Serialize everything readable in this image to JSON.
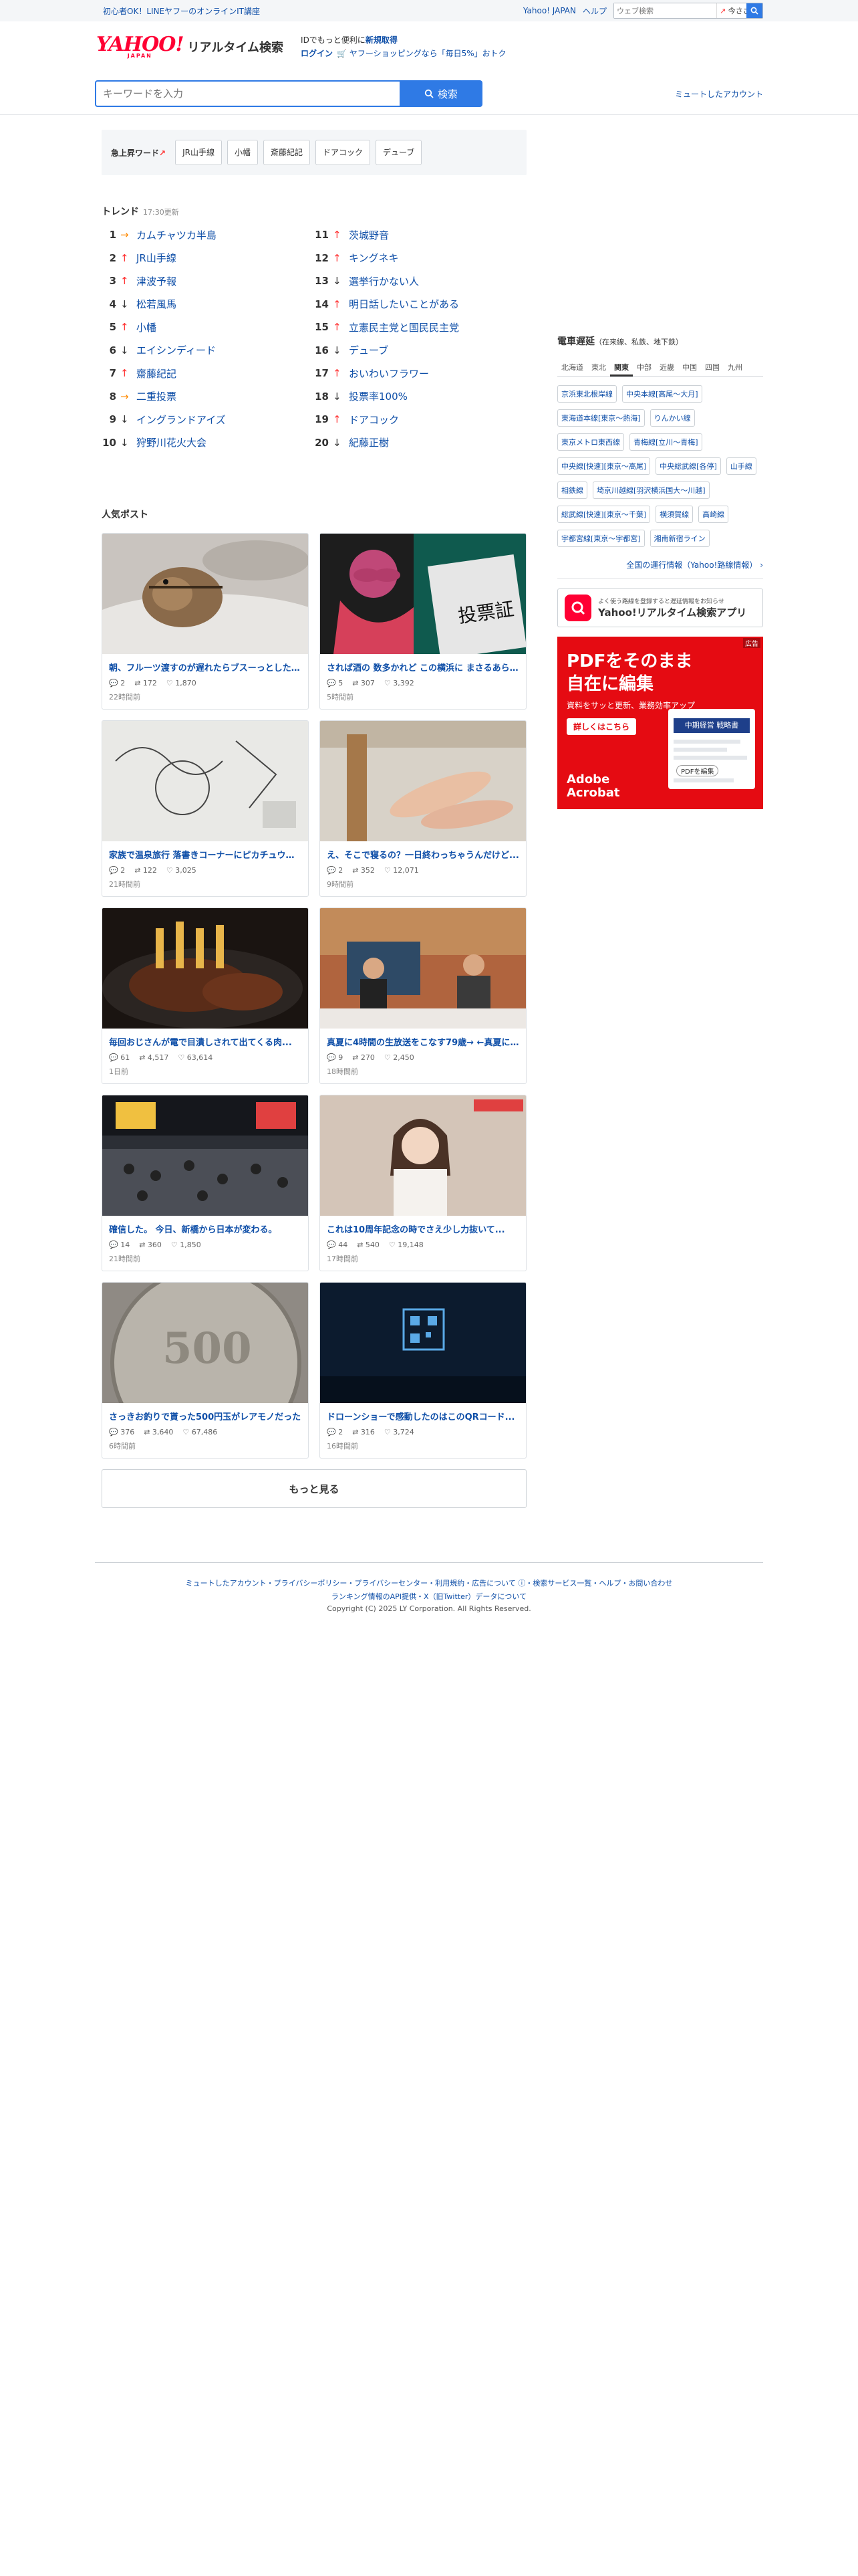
{
  "topbar": {
    "promo": "初心者OK！LINEヤフーのオンラインIT講座",
    "yahoo_japan": "Yahoo! JAPAN",
    "help": "ヘルプ",
    "web_search_placeholder": "ウェブ検索",
    "web_search_trend": "今ささえ行れ...",
    "search_icon": "search-icon"
  },
  "header": {
    "logo_main": "YAHOO!",
    "logo_sub": "JAPAN",
    "service_name": "リアルタイム検索",
    "msg_line1_prefix": "IDでもっと便利に",
    "msg_line1_link": "新規取得",
    "login": "ログイン",
    "msg_line2": "ヤフーショッピングなら「毎日5%」おトク"
  },
  "search": {
    "placeholder": "キーワードを入力",
    "button_label": "検索",
    "mute_link": "ミュートしたアカウント"
  },
  "surge": {
    "title": "急上昇ワード",
    "words": [
      "JR山手線",
      "小幡",
      "斎藤紀記",
      "ドアコック",
      "デューブ"
    ]
  },
  "trend": {
    "title": "トレンド",
    "updated": "17:30更新",
    "items": [
      {
        "rank": "1",
        "dir": "same",
        "word": "カムチャツカ半島"
      },
      {
        "rank": "2",
        "dir": "up",
        "word": "JR山手線"
      },
      {
        "rank": "3",
        "dir": "up",
        "word": "津波予報"
      },
      {
        "rank": "4",
        "dir": "down",
        "word": "松若風馬"
      },
      {
        "rank": "5",
        "dir": "up",
        "word": "小幡"
      },
      {
        "rank": "6",
        "dir": "down",
        "word": "エイシンディード"
      },
      {
        "rank": "7",
        "dir": "up",
        "word": "齋藤紀記"
      },
      {
        "rank": "8",
        "dir": "same",
        "word": "二重投票"
      },
      {
        "rank": "9",
        "dir": "down",
        "word": "イングランドアイズ"
      },
      {
        "rank": "10",
        "dir": "down",
        "word": "狩野川花火大会"
      },
      {
        "rank": "11",
        "dir": "up",
        "word": "茨城野音"
      },
      {
        "rank": "12",
        "dir": "up",
        "word": "キングネキ"
      },
      {
        "rank": "13",
        "dir": "down",
        "word": "選挙行かない人"
      },
      {
        "rank": "14",
        "dir": "up",
        "word": "明日話したいことがある"
      },
      {
        "rank": "15",
        "dir": "up",
        "word": "立憲民主党と国民民主党"
      },
      {
        "rank": "16",
        "dir": "down",
        "word": "デューブ"
      },
      {
        "rank": "17",
        "dir": "up",
        "word": "おいわいフラワー"
      },
      {
        "rank": "18",
        "dir": "down",
        "word": "投票率100%"
      },
      {
        "rank": "19",
        "dir": "up",
        "word": "ドアコック"
      },
      {
        "rank": "20",
        "dir": "down",
        "word": "紀藤正樹"
      }
    ]
  },
  "posts": {
    "title": "人気ポスト",
    "more": "もっと見る",
    "items": [
      {
        "title": "朝、フルーツ渡すのが遅れたらブスーっとした顔に...",
        "replies": "2",
        "reposts": "172",
        "likes": "1,870",
        "ago": "22時間前",
        "img": "chipmunk"
      },
      {
        "title": "されば酒の 数多かれど この横浜に まさるあらめや",
        "replies": "5",
        "reposts": "307",
        "likes": "3,392",
        "ago": "5時間前",
        "img": "manga"
      },
      {
        "title": "家族で温泉旅行 落書きコーナーにピカチュウを描く",
        "replies": "2",
        "reposts": "122",
        "likes": "3,025",
        "ago": "21時間前",
        "img": "sketch"
      },
      {
        "title": "え、そこで寝るの？一日終わっちゃうんだけど...",
        "replies": "2",
        "reposts": "352",
        "likes": "12,071",
        "ago": "9時間前",
        "img": "feet"
      },
      {
        "title": "毎回おじさんが電で目潰しされて出てくる肉...",
        "replies": "61",
        "reposts": "4,517",
        "likes": "63,614",
        "ago": "1日前",
        "img": "steak"
      },
      {
        "title": "真夏に4時間の生放送をこなす79歳→ ←真夏に...",
        "replies": "9",
        "reposts": "270",
        "likes": "2,450",
        "ago": "18時間前",
        "img": "tvstudio"
      },
      {
        "title": "確信した。 今日、新橋から日本が変わる。",
        "replies": "14",
        "reposts": "360",
        "likes": "1,850",
        "ago": "21時間前",
        "img": "crowd"
      },
      {
        "title": "これは10周年記念の時でさえ少し力抜いて...",
        "replies": "44",
        "reposts": "540",
        "likes": "19,148",
        "ago": "17時間前",
        "img": "actress"
      },
      {
        "title": "さっきお釣りで貰った500円玉がレアモノだった",
        "replies": "376",
        "reposts": "3,640",
        "likes": "67,486",
        "ago": "6時間前",
        "img": "coin"
      },
      {
        "title": "ドローンショーで感動したのはこのQRコード...",
        "replies": "2",
        "reposts": "316",
        "likes": "3,724",
        "ago": "16時間前",
        "img": "drone"
      }
    ]
  },
  "rail": {
    "title": "電車遅延",
    "title_sub": "（在来線、私鉄、地下鉄）",
    "regions": [
      "北海道",
      "東北",
      "関東",
      "中部",
      "近畿",
      "中国",
      "四国",
      "九州"
    ],
    "active_region": "関東",
    "lines": [
      "京浜東北根岸線",
      "中央本線[高尾〜大月]",
      "東海道本線[東京〜熱海]",
      "りんかい線",
      "東京メトロ東西線",
      "青梅線[立川〜青梅]",
      "中央線[快速][東京〜高尾]",
      "中央総武線[各停]",
      "山手線",
      "相鉄線",
      "埼京川越線[羽沢横浜国大〜川越]",
      "総武線[快速][東京〜千葉]",
      "横須賀線",
      "高崎線",
      "宇都宮線[東京〜宇都宮]",
      "湘南新宿ライン"
    ],
    "all_info": "全国の運行情報（Yahoo!路線情報）"
  },
  "app_banner": {
    "small": "よく使う路線を登録すると遅延情報をお知らせ",
    "name": "Yahoo!リアルタイム検索アプリ"
  },
  "ad": {
    "mark": "広告",
    "headline1": "PDFをそのまま",
    "headline2": "自在に編集",
    "sub": "資料をサッと更新、業務効率アップ",
    "cta": "詳しくはこちら",
    "brand1": "Adobe",
    "brand2": "Acrobat",
    "shot_title": "中期経営 戦略書",
    "shot_pill": "PDFを編集"
  },
  "footer": {
    "links": "ミュートしたアカウント・プライバシーポリシー・プライバシーセンター・利用規約・広告について ⓘ・検索サービス一覧・ヘルプ・お問い合わせ",
    "links2": "ランキング情報のAPI提供・X（旧Twitter）データについて",
    "copy": "Copyright (C) 2025 LY Corporation. All Rights Reserved."
  },
  "colors": {
    "accent": "#2f7ae5",
    "link": "#0f4fa8",
    "up": "#ff3333",
    "same": "#ff8a00",
    "brand_red": "#ff0033"
  }
}
